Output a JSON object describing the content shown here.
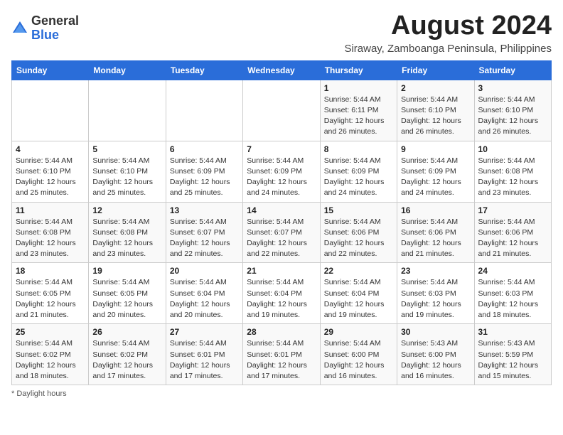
{
  "logo": {
    "general": "General",
    "blue": "Blue"
  },
  "title": "August 2024",
  "subtitle": "Siraway, Zamboanga Peninsula, Philippines",
  "days_of_week": [
    "Sunday",
    "Monday",
    "Tuesday",
    "Wednesday",
    "Thursday",
    "Friday",
    "Saturday"
  ],
  "footnote": "Daylight hours",
  "weeks": [
    [
      {
        "day": "",
        "info": ""
      },
      {
        "day": "",
        "info": ""
      },
      {
        "day": "",
        "info": ""
      },
      {
        "day": "",
        "info": ""
      },
      {
        "day": "1",
        "info": "Sunrise: 5:44 AM\nSunset: 6:11 PM\nDaylight: 12 hours\nand 26 minutes."
      },
      {
        "day": "2",
        "info": "Sunrise: 5:44 AM\nSunset: 6:10 PM\nDaylight: 12 hours\nand 26 minutes."
      },
      {
        "day": "3",
        "info": "Sunrise: 5:44 AM\nSunset: 6:10 PM\nDaylight: 12 hours\nand 26 minutes."
      }
    ],
    [
      {
        "day": "4",
        "info": "Sunrise: 5:44 AM\nSunset: 6:10 PM\nDaylight: 12 hours\nand 25 minutes."
      },
      {
        "day": "5",
        "info": "Sunrise: 5:44 AM\nSunset: 6:10 PM\nDaylight: 12 hours\nand 25 minutes."
      },
      {
        "day": "6",
        "info": "Sunrise: 5:44 AM\nSunset: 6:09 PM\nDaylight: 12 hours\nand 25 minutes."
      },
      {
        "day": "7",
        "info": "Sunrise: 5:44 AM\nSunset: 6:09 PM\nDaylight: 12 hours\nand 24 minutes."
      },
      {
        "day": "8",
        "info": "Sunrise: 5:44 AM\nSunset: 6:09 PM\nDaylight: 12 hours\nand 24 minutes."
      },
      {
        "day": "9",
        "info": "Sunrise: 5:44 AM\nSunset: 6:09 PM\nDaylight: 12 hours\nand 24 minutes."
      },
      {
        "day": "10",
        "info": "Sunrise: 5:44 AM\nSunset: 6:08 PM\nDaylight: 12 hours\nand 23 minutes."
      }
    ],
    [
      {
        "day": "11",
        "info": "Sunrise: 5:44 AM\nSunset: 6:08 PM\nDaylight: 12 hours\nand 23 minutes."
      },
      {
        "day": "12",
        "info": "Sunrise: 5:44 AM\nSunset: 6:08 PM\nDaylight: 12 hours\nand 23 minutes."
      },
      {
        "day": "13",
        "info": "Sunrise: 5:44 AM\nSunset: 6:07 PM\nDaylight: 12 hours\nand 22 minutes."
      },
      {
        "day": "14",
        "info": "Sunrise: 5:44 AM\nSunset: 6:07 PM\nDaylight: 12 hours\nand 22 minutes."
      },
      {
        "day": "15",
        "info": "Sunrise: 5:44 AM\nSunset: 6:06 PM\nDaylight: 12 hours\nand 22 minutes."
      },
      {
        "day": "16",
        "info": "Sunrise: 5:44 AM\nSunset: 6:06 PM\nDaylight: 12 hours\nand 21 minutes."
      },
      {
        "day": "17",
        "info": "Sunrise: 5:44 AM\nSunset: 6:06 PM\nDaylight: 12 hours\nand 21 minutes."
      }
    ],
    [
      {
        "day": "18",
        "info": "Sunrise: 5:44 AM\nSunset: 6:05 PM\nDaylight: 12 hours\nand 21 minutes."
      },
      {
        "day": "19",
        "info": "Sunrise: 5:44 AM\nSunset: 6:05 PM\nDaylight: 12 hours\nand 20 minutes."
      },
      {
        "day": "20",
        "info": "Sunrise: 5:44 AM\nSunset: 6:04 PM\nDaylight: 12 hours\nand 20 minutes."
      },
      {
        "day": "21",
        "info": "Sunrise: 5:44 AM\nSunset: 6:04 PM\nDaylight: 12 hours\nand 19 minutes."
      },
      {
        "day": "22",
        "info": "Sunrise: 5:44 AM\nSunset: 6:04 PM\nDaylight: 12 hours\nand 19 minutes."
      },
      {
        "day": "23",
        "info": "Sunrise: 5:44 AM\nSunset: 6:03 PM\nDaylight: 12 hours\nand 19 minutes."
      },
      {
        "day": "24",
        "info": "Sunrise: 5:44 AM\nSunset: 6:03 PM\nDaylight: 12 hours\nand 18 minutes."
      }
    ],
    [
      {
        "day": "25",
        "info": "Sunrise: 5:44 AM\nSunset: 6:02 PM\nDaylight: 12 hours\nand 18 minutes."
      },
      {
        "day": "26",
        "info": "Sunrise: 5:44 AM\nSunset: 6:02 PM\nDaylight: 12 hours\nand 17 minutes."
      },
      {
        "day": "27",
        "info": "Sunrise: 5:44 AM\nSunset: 6:01 PM\nDaylight: 12 hours\nand 17 minutes."
      },
      {
        "day": "28",
        "info": "Sunrise: 5:44 AM\nSunset: 6:01 PM\nDaylight: 12 hours\nand 17 minutes."
      },
      {
        "day": "29",
        "info": "Sunrise: 5:44 AM\nSunset: 6:00 PM\nDaylight: 12 hours\nand 16 minutes."
      },
      {
        "day": "30",
        "info": "Sunrise: 5:43 AM\nSunset: 6:00 PM\nDaylight: 12 hours\nand 16 minutes."
      },
      {
        "day": "31",
        "info": "Sunrise: 5:43 AM\nSunset: 5:59 PM\nDaylight: 12 hours\nand 15 minutes."
      }
    ]
  ]
}
